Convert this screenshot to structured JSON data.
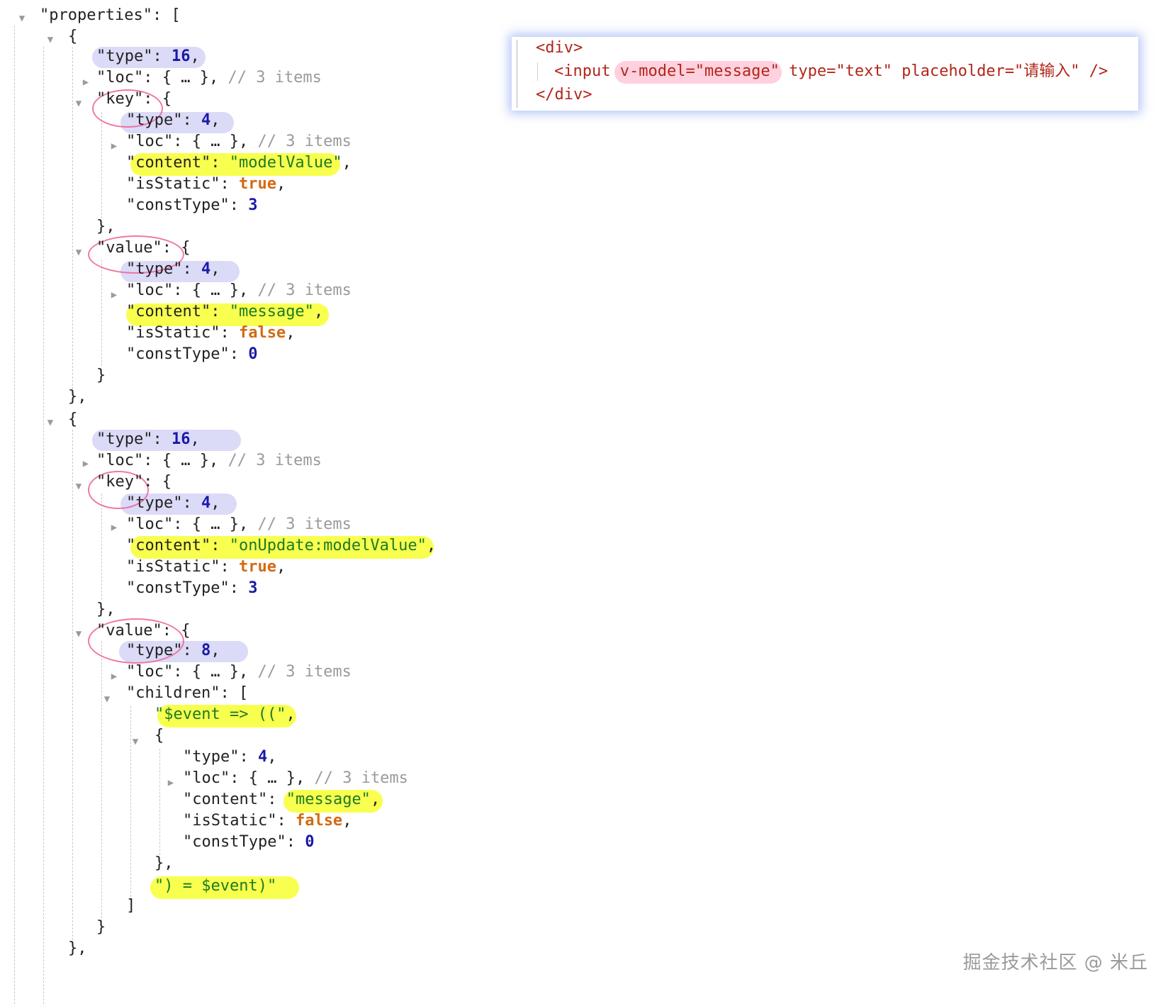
{
  "code_card": {
    "line1": "<div>",
    "line2_tag": "<input",
    "line2_attr1": " v-model=\"message\"",
    "line2_attr2": " type=\"text\"",
    "line2_attr3": " placeholder=\"请输入\"",
    "line2_close": " />",
    "line3": "</div>"
  },
  "watermark": "掘金技术社区 @ 米丘",
  "tokens": {
    "properties_key": "\"properties\"",
    "type_key": "\"type\"",
    "loc_key": "\"loc\"",
    "key_key": "\"key\"",
    "value_key": "\"value\"",
    "content_key": "\"content\"",
    "isStatic_key": "\"isStatic\"",
    "constType_key": "\"constType\"",
    "children_key": "\"children\"",
    "collapsed": "{ … }",
    "items_comment": "// 3 items"
  },
  "values": {
    "prop_type": "16",
    "node_type": "4",
    "compound_type": "8",
    "true": "true",
    "false": "false",
    "const3": "3",
    "const0": "0",
    "content_modelValue": "\"modelValue\"",
    "content_message": "\"message\"",
    "content_onUpdate": "\"onUpdate:modelValue\"",
    "child1": "\"$event => ((\"",
    "child3": "\") = $event)\""
  }
}
